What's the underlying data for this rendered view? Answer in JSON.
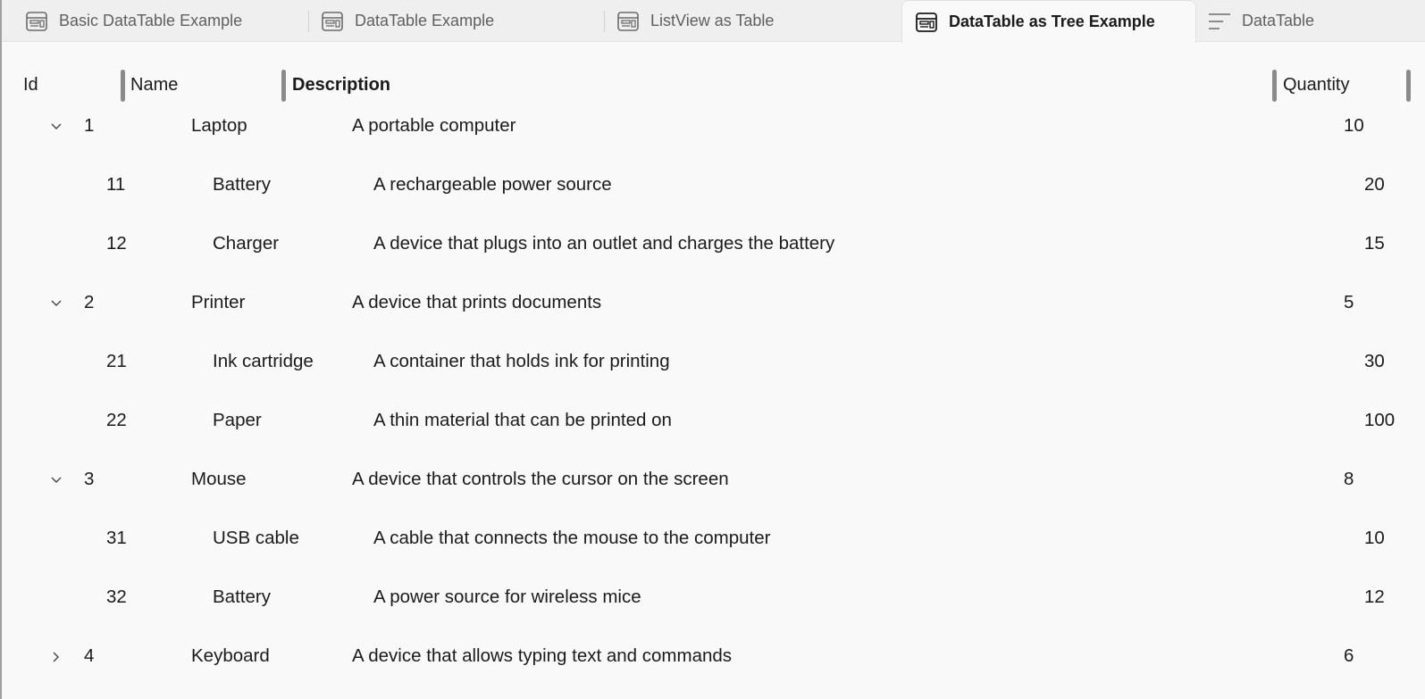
{
  "tabs": [
    {
      "label": "Basic DataTable Example",
      "icon": "table-layout-icon",
      "selected": false
    },
    {
      "label": "DataTable Example",
      "icon": "table-layout-icon",
      "selected": false
    },
    {
      "label": "ListView as Table",
      "icon": "table-layout-icon",
      "selected": false
    },
    {
      "label": "DataTable as Tree Example",
      "icon": "table-layout-icon",
      "selected": true
    },
    {
      "label": "DataTable",
      "icon": "lines-icon",
      "selected": false
    }
  ],
  "table": {
    "columns": {
      "id": "Id",
      "name": "Name",
      "description": "Description",
      "quantity": "Quantity"
    },
    "sorted_column": "Description",
    "rows": [
      {
        "level": 0,
        "expander": "expanded",
        "id": "1",
        "name": "Laptop",
        "description": "A portable computer",
        "quantity": "10"
      },
      {
        "level": 1,
        "expander": "none",
        "id": "11",
        "name": "Battery",
        "description": "A rechargeable power source",
        "quantity": "20"
      },
      {
        "level": 1,
        "expander": "none",
        "id": "12",
        "name": "Charger",
        "description": "A device that plugs into an outlet and charges the battery",
        "quantity": "15"
      },
      {
        "level": 0,
        "expander": "expanded",
        "id": "2",
        "name": "Printer",
        "description": "A device that prints documents",
        "quantity": "5"
      },
      {
        "level": 1,
        "expander": "none",
        "id": "21",
        "name": "Ink cartridge",
        "description": "A container that holds ink for printing",
        "quantity": "30"
      },
      {
        "level": 1,
        "expander": "none",
        "id": "22",
        "name": "Paper",
        "description": "A thin material that can be printed on",
        "quantity": "100"
      },
      {
        "level": 0,
        "expander": "expanded",
        "id": "3",
        "name": "Mouse",
        "description": "A device that controls the cursor on the screen",
        "quantity": "8"
      },
      {
        "level": 1,
        "expander": "none",
        "id": "31",
        "name": "USB cable",
        "description": "A cable that connects the mouse to the computer",
        "quantity": "10"
      },
      {
        "level": 1,
        "expander": "none",
        "id": "32",
        "name": "Battery",
        "description": "A power source for wireless mice",
        "quantity": "12"
      },
      {
        "level": 0,
        "expander": "collapsed",
        "id": "4",
        "name": "Keyboard",
        "description": "A device that allows typing text and commands",
        "quantity": "6"
      }
    ]
  },
  "colors": {
    "background": "#f9f9f9",
    "tabstrip": "#efefef",
    "text": "#1b1b1b",
    "muted_text": "#5f5f5f",
    "grip": "#8a8a8a"
  }
}
